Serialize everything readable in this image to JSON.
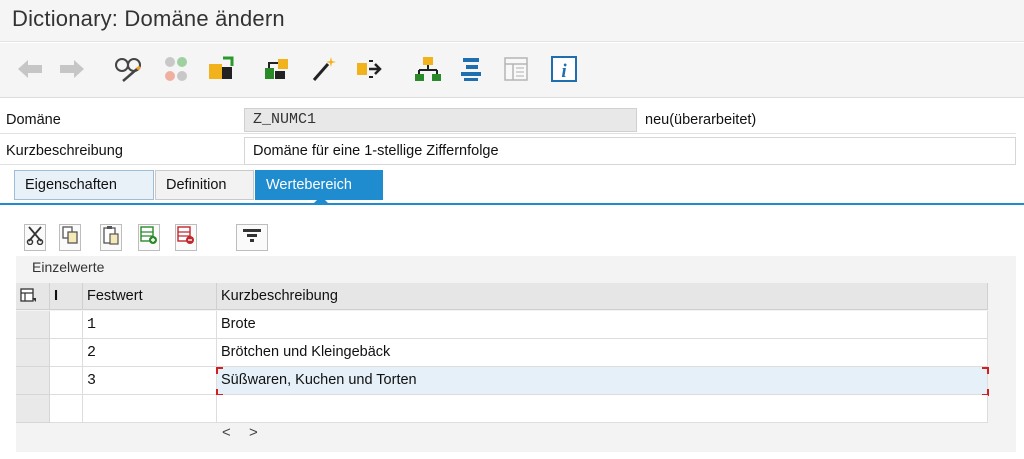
{
  "window": {
    "title": "Dictionary: Domäne ändern"
  },
  "toolbar": {
    "icons": [
      "back-arrow-icon",
      "forward-arrow-icon",
      "display-change-icon",
      "other-object-icon",
      "activate-icon",
      "check-icon",
      "where-used-icon",
      "magic-wand-icon",
      "navigate-icon",
      "hierarchy-icon",
      "list-icon",
      "layout-icon",
      "info-icon"
    ],
    "info_glyph": "i"
  },
  "form": {
    "domain_label": "Domäne",
    "domain_value": "Z_NUMC1",
    "domain_status": "neu(überarbeitet)",
    "short_desc_label": "Kurzbeschreibung",
    "short_desc_value": "Domäne für eine 1-stellige Ziffernfolge"
  },
  "tabs": [
    {
      "label": "Eigenschaften",
      "active": false
    },
    {
      "label": "Definition",
      "active": false
    },
    {
      "label": "Wertebereich",
      "active": true
    }
  ],
  "table_toolbar": {
    "icons": [
      "cut-icon",
      "copy-icon",
      "paste-icon",
      "insert-row-icon",
      "delete-row-icon",
      "filter-icon"
    ]
  },
  "values_table": {
    "title": "Einzelwerte",
    "columns": [
      "I",
      "Festwert",
      "Kurzbeschreibung"
    ],
    "rows": [
      {
        "festwert": "1",
        "kurzbeschreibung": "Brote"
      },
      {
        "festwert": "2",
        "kurzbeschreibung": "Brötchen und Kleingebäck"
      },
      {
        "festwert": "3",
        "kurzbeschreibung": "Süßwaren, Kuchen und Torten"
      },
      {
        "festwert": "",
        "kurzbeschreibung": ""
      }
    ],
    "scroll": {
      "left": "<",
      "right": ">"
    }
  },
  "colors": {
    "accent": "#1f8ccf",
    "focus_marker": "#d21f1f"
  }
}
